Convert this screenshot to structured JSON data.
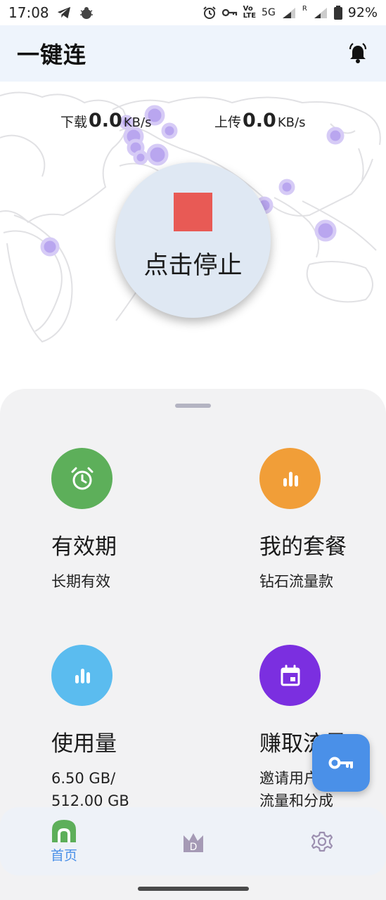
{
  "status": {
    "time": "17:08",
    "battery": "92%",
    "network": "5G",
    "volte_top": "Vo",
    "volte_bottom": "LTE",
    "roaming": "R"
  },
  "header": {
    "title": "一键连"
  },
  "hero": {
    "download_label": "下载",
    "download_value": "0.0",
    "download_unit": "KB/s",
    "upload_label": "上传",
    "upload_value": "0.0",
    "upload_unit": "KB/s",
    "stop_label": "点击停止",
    "stop_color": "#e85a55"
  },
  "cards": {
    "validity": {
      "title": "有效期",
      "sub": "长期有效",
      "icon": "alarm-clock-icon",
      "color": "#5daf5a"
    },
    "plan": {
      "title": "我的套餐",
      "sub": "钻石流量款",
      "icon": "bar-chart-icon",
      "color": "#f19e38"
    },
    "usage": {
      "title": "使用量",
      "sub_line1": "6.50 GB/",
      "sub_line2": "512.00 GB",
      "icon": "bar-chart-icon",
      "color": "#5bbcef"
    },
    "earn": {
      "title": "赚取流量",
      "sub_line1": "邀请用户获取",
      "sub_line2": "流量和分成",
      "icon": "calendar-icon",
      "color": "#7b2fe0"
    }
  },
  "tabs": {
    "home": "首页",
    "accent": "#4a90e8",
    "home_icon_color": "#5daf5a"
  }
}
